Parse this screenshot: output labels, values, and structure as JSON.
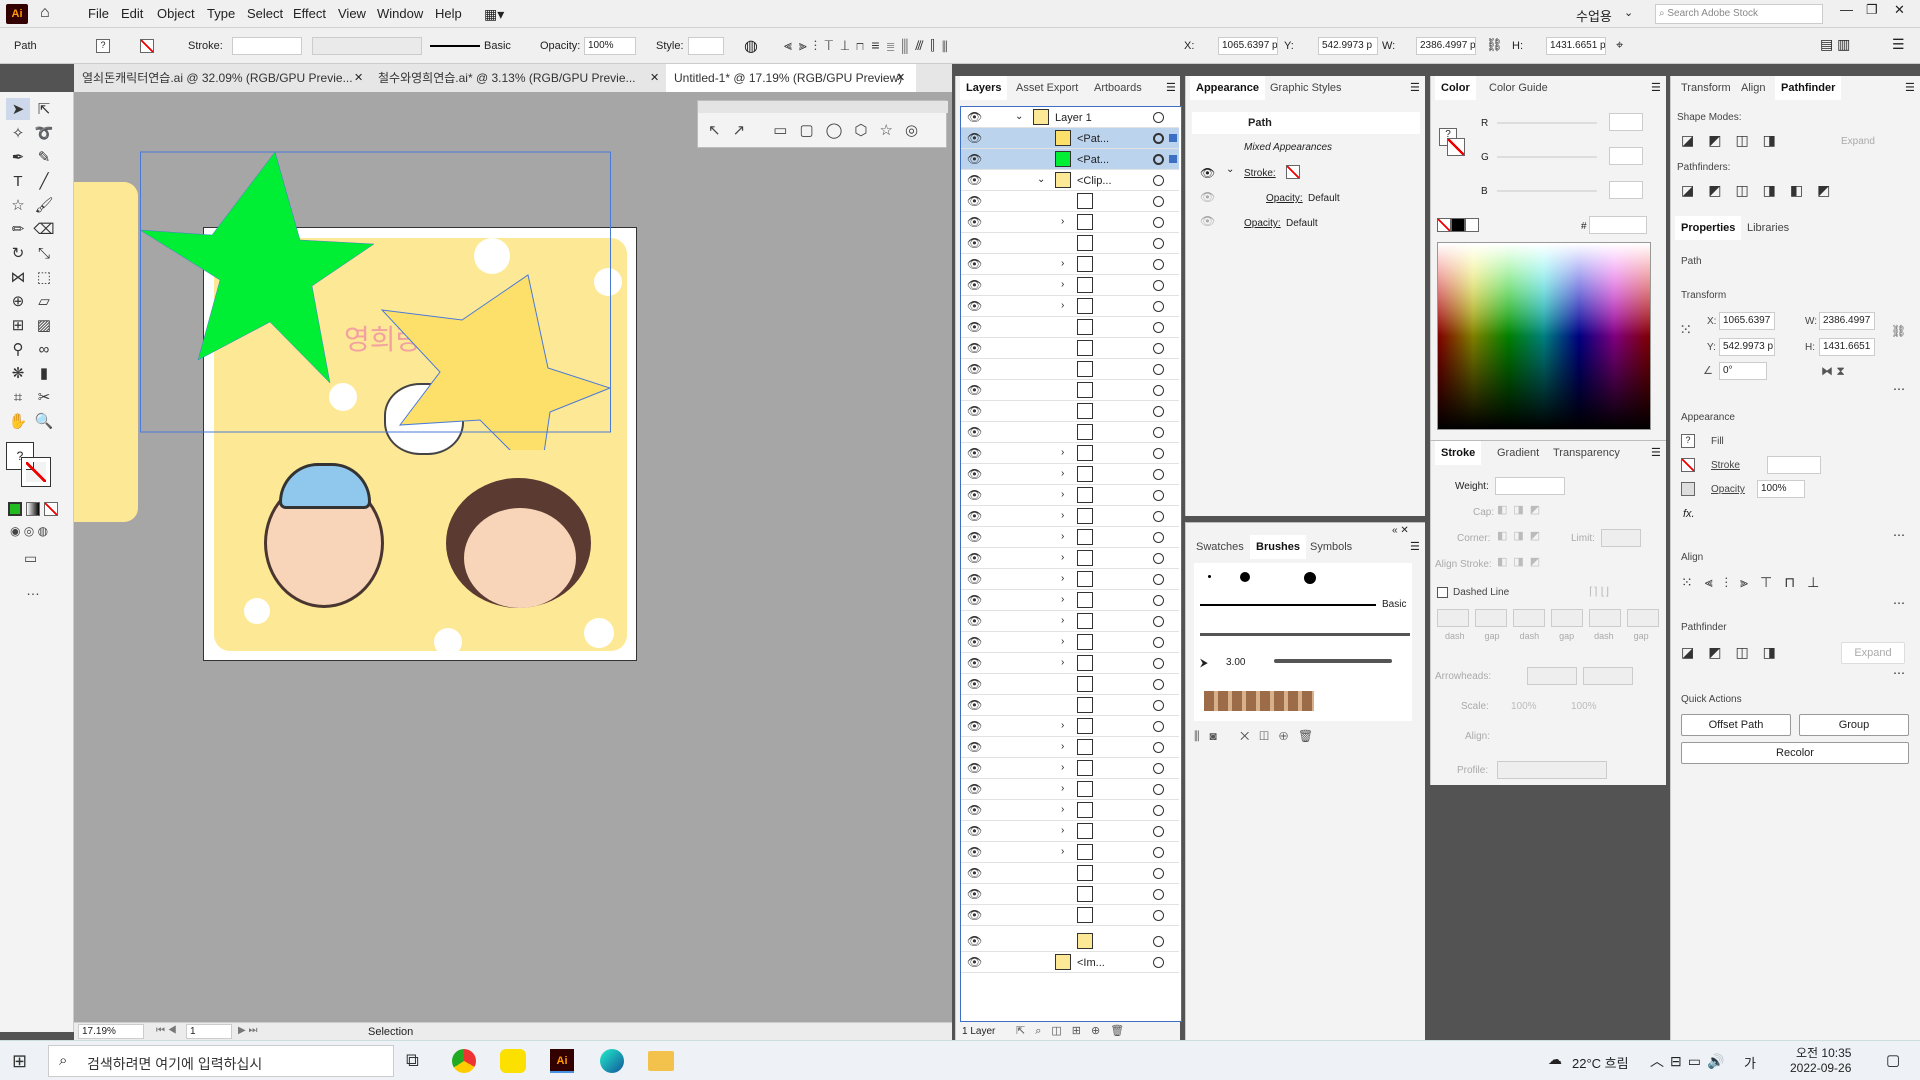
{
  "menubar": {
    "app_logo": "Ai",
    "items": [
      "File",
      "Edit",
      "Object",
      "Type",
      "Select",
      "Effect",
      "View",
      "Window",
      "Help"
    ],
    "workspace": "수업용",
    "search_placeholder": "Search Adobe Stock"
  },
  "control": {
    "object_type": "Path",
    "stroke_label": "Stroke:",
    "brush": "Basic",
    "opacity_label": "Opacity:",
    "opacity": "100%",
    "style_label": "Style:",
    "x_label": "X:",
    "x": "1065.6397 p",
    "y_label": "Y:",
    "y": "542.9973 p",
    "w_label": "W:",
    "w": "2386.4997 p",
    "h_label": "H:",
    "h": "1431.6651 p"
  },
  "tabs": [
    {
      "label": "열쇠돈캐릭터연습.ai @ 32.09% (RGB/GPU Previe..."
    },
    {
      "label": "철수와영희연습.ai* @ 3.13% (RGB/GPU Previe..."
    },
    {
      "label": "Untitled-1* @ 17.19% (RGB/GPU Preview)",
      "active": true
    }
  ],
  "artwork": {
    "title_text": "영희랑 고양이랑",
    "colors": {
      "background": "#fde995",
      "green_star": "#00ee33",
      "yellow_star": "#fde06a",
      "pink_text": "#f2a0a0"
    }
  },
  "layers_panel": {
    "tabs": [
      "Layers",
      "Asset Export",
      "Artboards"
    ],
    "layer_name": "Layer 1",
    "items": [
      {
        "label": "<Pat..."
      },
      {
        "label": "<Pat..."
      },
      {
        "label": "<Clip..."
      }
    ],
    "last_item": "<Im...",
    "footer": "1 Layer"
  },
  "appearance_panel": {
    "tabs": [
      "Appearance",
      "Graphic Styles"
    ],
    "object": "Path",
    "mixed": "Mixed Appearances",
    "stroke_label": "Stroke:",
    "opacity_label": "Opacity:",
    "opacity_value": "Default",
    "opacity2_label": "Opacity:",
    "opacity2_value": "Default"
  },
  "color_panel": {
    "tabs": [
      "Color",
      "Color Guide"
    ],
    "r": "R",
    "g": "G",
    "b": "B",
    "hash": "#"
  },
  "stroke_panel": {
    "tabs": [
      "Stroke",
      "Gradient",
      "Transparency"
    ],
    "weight_label": "Weight:",
    "cap_label": "Cap:",
    "corner_label": "Corner:",
    "limit_label": "Limit:",
    "align_label": "Align Stroke:",
    "dashed_label": "Dashed Line",
    "dash_labels": [
      "dash",
      "gap",
      "dash",
      "gap",
      "dash",
      "gap"
    ],
    "arrowheads_label": "Arrowheads:",
    "scale_label": "Scale:",
    "scale1": "100%",
    "scale2": "100%",
    "align2_label": "Align:",
    "profile_label": "Profile:"
  },
  "swatches_panel": {
    "tabs": [
      "Swatches",
      "Brushes",
      "Symbols"
    ],
    "basic_label": "Basic",
    "brush_size": "3.00"
  },
  "right_panel": {
    "top_tabs": [
      "Transform",
      "Align",
      "Pathfinder"
    ],
    "shape_modes": "Shape Modes:",
    "expand": "Expand",
    "pathfinders": "Pathfinders:",
    "prop_tabs": [
      "Properties",
      "Libraries"
    ],
    "object": "Path",
    "transform_label": "Transform",
    "x_label": "X:",
    "x": "1065.6397",
    "y_label": "Y:",
    "y": "542.9973 p",
    "w_label": "W:",
    "w": "2386.4997",
    "h_label": "H:",
    "h": "1431.6651",
    "angle": "0°",
    "appearance_label": "Appearance",
    "fill_label": "Fill",
    "stroke_label": "Stroke",
    "opacity_label": "Opacity",
    "opacity": "100%",
    "fx": "fx.",
    "align_label": "Align",
    "pathfinder_label": "Pathfinder",
    "expand2": "Expand",
    "quick_actions": "Quick Actions",
    "offset_path": "Offset Path",
    "group": "Group",
    "recolor": "Recolor"
  },
  "status": {
    "zoom": "17.19%",
    "page": "1",
    "tool": "Selection"
  },
  "taskbar": {
    "search_placeholder": "검색하려면 여기에 입력하십시",
    "weather": "22°C 흐림",
    "ime": "가",
    "time": "오전 10:35",
    "date": "2022-09-26"
  }
}
